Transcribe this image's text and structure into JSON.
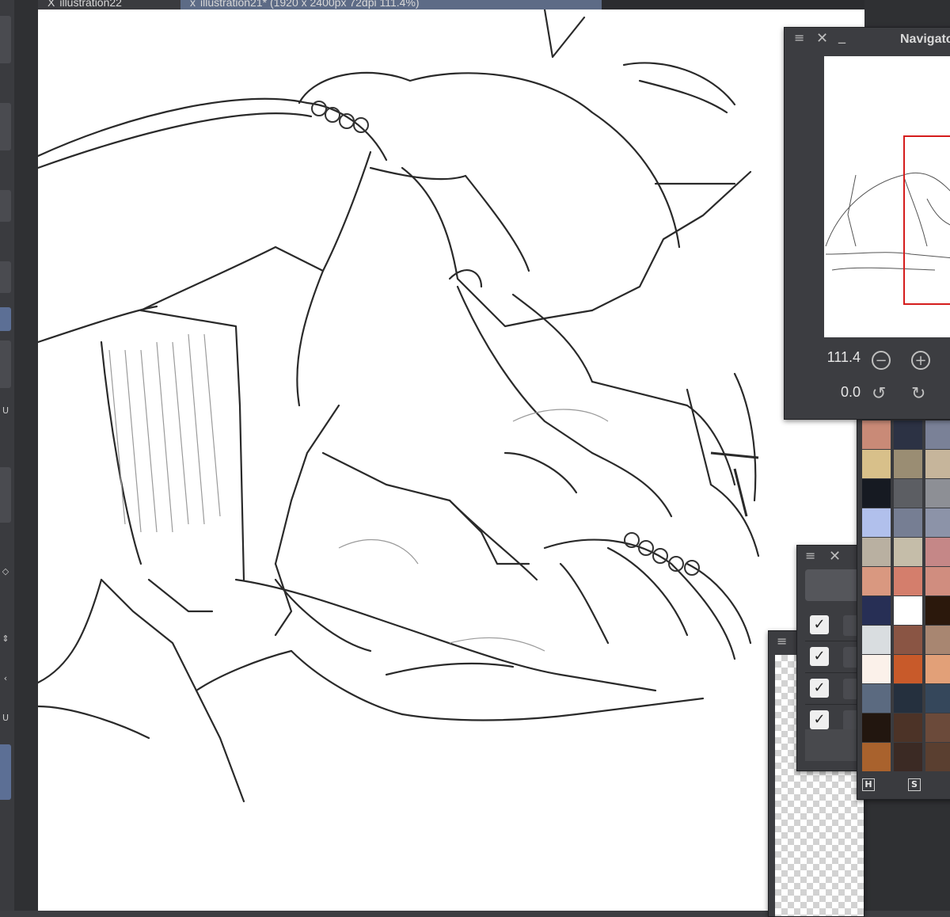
{
  "tabs": [
    {
      "close": "X",
      "label": "illustration22"
    },
    {
      "close": "x",
      "label": "illustration21* (1920 x 2400px 72dpi 111.4%)"
    }
  ],
  "navigator": {
    "title": "Navigator",
    "zoom": "111.4",
    "rotation": "0.0",
    "zoom_out_icon": "minus-circle-icon",
    "zoom_in_icon": "plus-circle-icon",
    "rotate_left_icon": "rotate-ccw-icon",
    "rotate_right_icon": "rotate-cw-icon"
  },
  "palette": {
    "colors": [
      [
        "#c98a77",
        "#2c3244",
        "#7a8197"
      ],
      [
        "#d8c08a",
        "#9a8d73",
        "#c6b59b"
      ],
      [
        "#161a22",
        "#5c5e63",
        "#8d8f95"
      ],
      [
        "#b1c0ec",
        "#767e93",
        "#8c93a8"
      ],
      [
        "#b9b0a1",
        "#c5bda9",
        "#c58787"
      ],
      [
        "#d99880",
        "#d47e6c",
        "#d08d7f"
      ],
      [
        "#272f55",
        "#ffffff",
        "#2b180c"
      ],
      [
        "#d9dde0",
        "#8a5544",
        "#a88671"
      ],
      [
        "#fbf1ea",
        "#c85a2a",
        "#e2a078"
      ],
      [
        "#5b6a80",
        "#25303e",
        "#35475b"
      ],
      [
        "#22160f",
        "#4c3327",
        "#6b4a3a"
      ],
      [
        "#a9622d",
        "#3b2a24",
        "#5a3f30"
      ]
    ],
    "hue_button": "H",
    "sat_button": "S"
  },
  "layers": {
    "rows": 4,
    "checkmark": "✓"
  },
  "left_tools": {
    "glyphs": [
      "U",
      "◇",
      "U"
    ]
  }
}
